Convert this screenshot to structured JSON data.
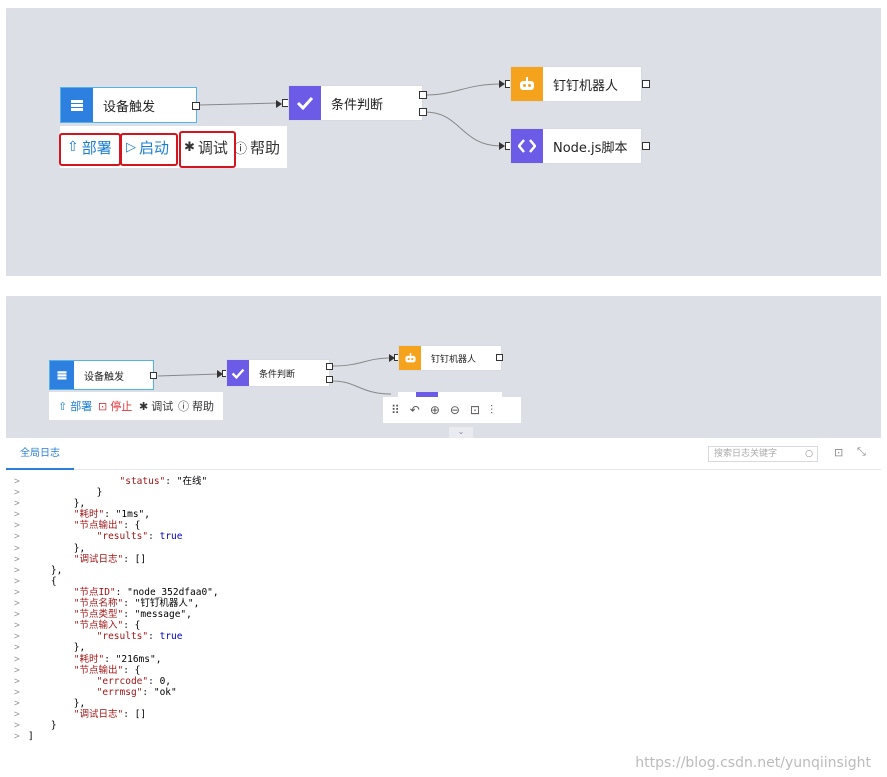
{
  "top_canvas": {
    "nodes": {
      "trigger": "设备触发",
      "condition": "条件判断",
      "robot": "钉钉机器人",
      "script": "Node.js脚本"
    },
    "toolbar": {
      "deploy": "部署",
      "start": "启动",
      "debug": "调试",
      "help": "帮助"
    }
  },
  "bottom_canvas": {
    "nodes": {
      "trigger": "设备触发",
      "condition": "条件判断",
      "robot": "钉钉机器人"
    },
    "toolbar": {
      "deploy": "部署",
      "stop": "停止",
      "debug": "调试",
      "help": "帮助"
    }
  },
  "log_panel": {
    "tab": "全局日志",
    "search_placeholder": "搜索日志关键字",
    "lines": [
      "                \"status\": \"在线\"",
      "            }",
      "        },",
      "        \"耗时\": \"1ms\",",
      "        \"节点输出\": {",
      "            \"results\": true",
      "        },",
      "        \"调试日志\": []",
      "    },",
      "    {",
      "        \"节点ID\": \"node_352dfaa0\",",
      "        \"节点名称\": \"钉钉机器人\",",
      "        \"节点类型\": \"message\",",
      "        \"节点输入\": {",
      "            \"results\": true",
      "        },",
      "        \"耗时\": \"216ms\",",
      "        \"节点输出\": {",
      "            \"errcode\": 0,",
      "            \"errmsg\": \"ok\"",
      "        },",
      "        \"调试日志\": []",
      "    }",
      "]"
    ]
  },
  "watermark": "https://blog.csdn.net/yunqiinsight",
  "colors": {
    "canvas_bg": "#dcdfe6",
    "trigger_icon": "#2d7fe0",
    "condition_icon": "#6b5be6",
    "robot_icon": "#f5a21d",
    "script_icon": "#6b5be6",
    "highlight": "#d3151f",
    "link_blue": "#1a7fd4",
    "stop_red": "#e0343b"
  }
}
